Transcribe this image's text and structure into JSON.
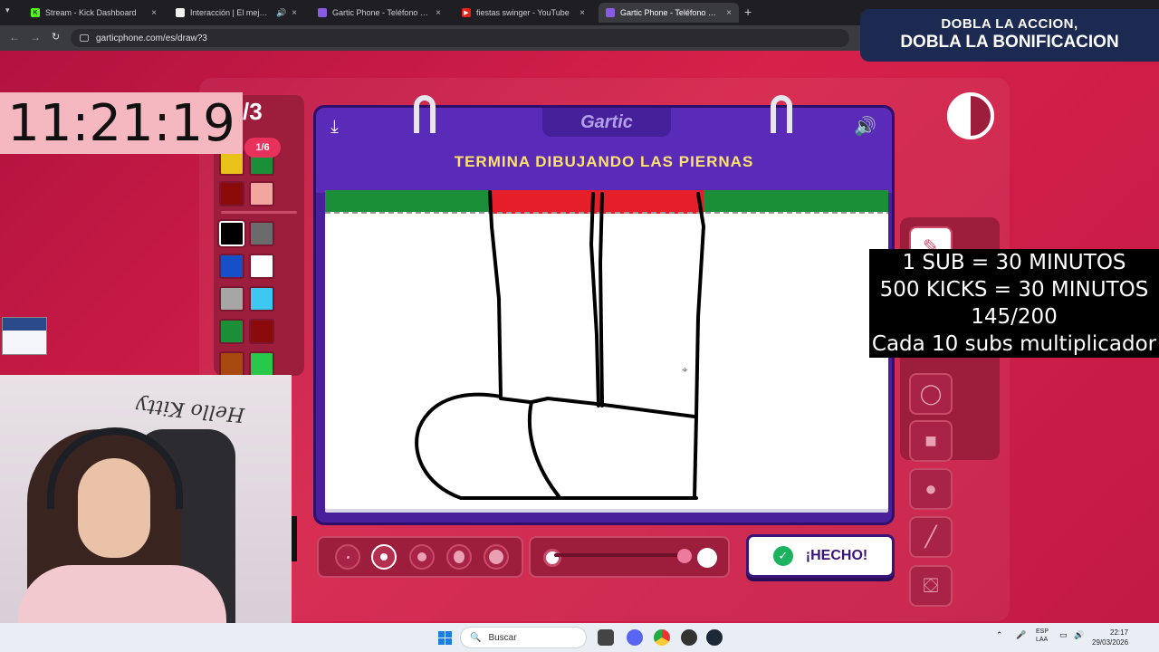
{
  "browser": {
    "tabs": [
      {
        "label": "Stream - Kick Dashboard",
        "fav_color": "#1a1a1a",
        "fav_text": "K",
        "active": false
      },
      {
        "label": "Interacción | El mejor softw",
        "fav_color": "#1a1a1a",
        "fav_text": "",
        "active": false
      },
      {
        "label": "Gartic Phone - Teléfono Descon",
        "fav_color": "#5a2ab8",
        "fav_text": "",
        "active": false
      },
      {
        "label": "fiestas swinger - YouTube",
        "fav_color": "#e62117",
        "fav_text": "▶",
        "active": false
      },
      {
        "label": "Gartic Phone - Teléfono Descon",
        "fav_color": "#5a2ab8",
        "fav_text": "",
        "active": true
      }
    ],
    "new_tab": "+",
    "tab_close": "×",
    "url": "garticphone.com/es/draw?3"
  },
  "promo": {
    "line1": "DOBLA LA ACCION,",
    "line2": "DOBLA LA BONIFICACION"
  },
  "clock": "11:21:19",
  "game": {
    "round": "/3",
    "turn": "1/6",
    "logo": "Gartic",
    "prompt": "TERMINA DIBUJANDO LAS PIERNAS",
    "done_label": "¡HECHO!"
  },
  "palette": {
    "colors": [
      "#e8c21a",
      "#1a8f38",
      "#8b0a0a",
      "#f3a6a0",
      "#000000",
      "#6b6b6b",
      "#1650c8",
      "#ffffff",
      "#a6a6a6",
      "#3cc8f0",
      "#1a8f38",
      "#8b0a0a",
      "#a84a10",
      "#2ac84a"
    ],
    "selected": "#000000"
  },
  "brushes": [
    "size-1",
    "size-2",
    "size-3",
    "size-4",
    "size-5"
  ],
  "subs_overlay": {
    "line1": "1 SUB      = 30 MINUTOS",
    "line2": "500 KICKS = 30 MINUTOS",
    "line3": "145/200",
    "line4": "Cada 10 subs multiplicador"
  },
  "webcam": {
    "backdrop_text": "Hello Kitty"
  },
  "taskbar": {
    "search_placeholder": "Buscar",
    "lang_1": "ESP",
    "lang_2": "LAA",
    "time": "22:17",
    "date": "29/03/2026"
  }
}
